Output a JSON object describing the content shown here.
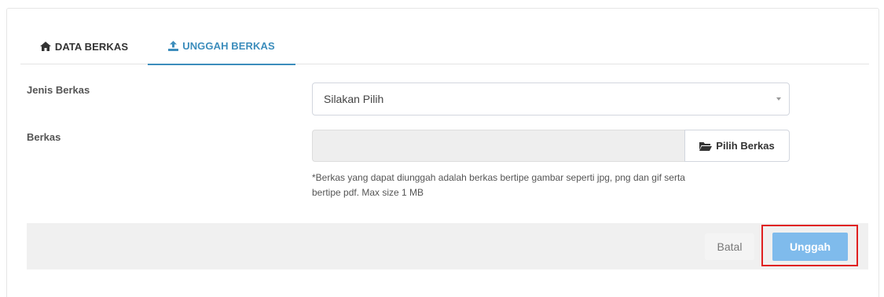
{
  "tabs": [
    {
      "label": "DATA BERKAS",
      "icon": "home-icon",
      "active": false
    },
    {
      "label": "UNGGAH BERKAS",
      "icon": "upload-icon",
      "active": true
    }
  ],
  "form": {
    "jenis_label": "Jenis Berkas",
    "jenis_value": "Silakan Pilih",
    "berkas_label": "Berkas",
    "berkas_value": "",
    "pick_button": "Pilih Berkas",
    "help_line1": "*Berkas yang dapat diunggah adalah berkas bertipe gambar seperti jpg, png dan gif serta",
    "help_line2": "bertipe pdf. Max size 1 MB"
  },
  "footer": {
    "cancel_label": "Batal",
    "submit_label": "Unggah"
  },
  "colors": {
    "accent": "#3c8dbc",
    "submit": "#7fbbec",
    "highlight": "#e02020"
  }
}
